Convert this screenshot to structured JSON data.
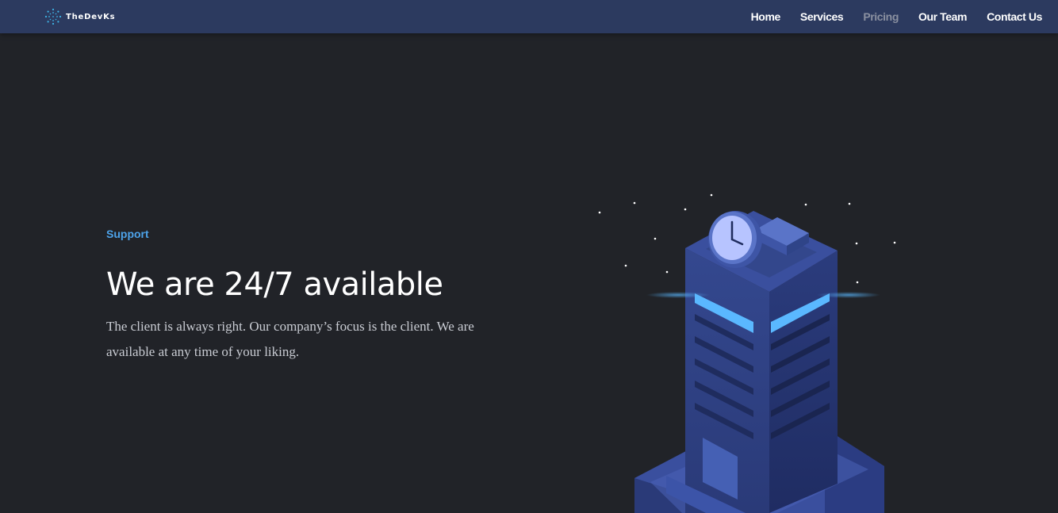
{
  "nav": {
    "brand": {
      "name": "TheDevKs",
      "icon": "dotted-circle-logo-icon"
    },
    "links": [
      {
        "label": "Home",
        "active": false
      },
      {
        "label": "Services",
        "active": false
      },
      {
        "label": "Pricing",
        "active": true
      },
      {
        "label": "Our Team",
        "active": false
      },
      {
        "label": "Contact Us",
        "active": false
      }
    ]
  },
  "hero": {
    "eyebrow": "Support",
    "headline": "We are 24/7 available",
    "description": "The client is always right. Our company’s focus is the client. We are available at any time of your liking.",
    "illustration": "isometric-clock-building-icon"
  },
  "colors": {
    "navbar_bg": "#2c3a5f",
    "page_bg": "#212328",
    "accent": "#4da3ea",
    "active_link": "#8a90a0"
  }
}
